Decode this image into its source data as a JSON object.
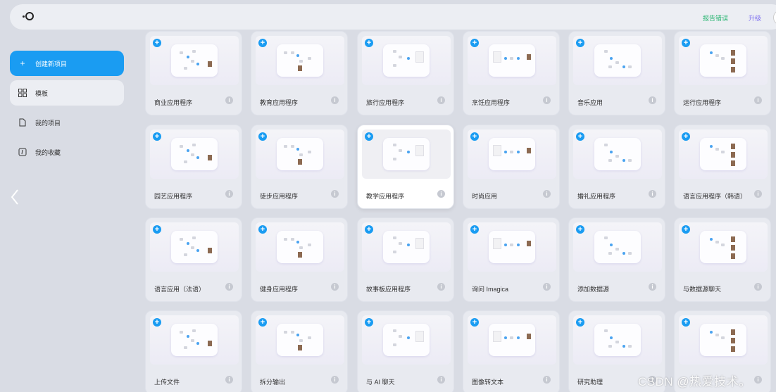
{
  "header": {
    "feedback_label": "报告错误",
    "upgrade_label": "升级"
  },
  "sidebar": {
    "items": [
      {
        "label": "创建新项目",
        "icon": "plus-icon"
      },
      {
        "label": "模板",
        "icon": "grid-icon"
      },
      {
        "label": "我的项目",
        "icon": "file-icon"
      },
      {
        "label": "我的收藏",
        "icon": "bookmark-icon"
      }
    ]
  },
  "templates": [
    {
      "title": "商业应用程序"
    },
    {
      "title": "教育应用程序"
    },
    {
      "title": "旅行应用程序"
    },
    {
      "title": "烹饪应用程序"
    },
    {
      "title": "音乐应用"
    },
    {
      "title": "运行应用程序"
    },
    {
      "title": "园艺应用程序"
    },
    {
      "title": "徒步应用程序"
    },
    {
      "title": "教学应用程序"
    },
    {
      "title": "时尚应用"
    },
    {
      "title": "婚礼应用程序"
    },
    {
      "title": "语言应用程序（韩语）"
    },
    {
      "title": "语言应用（法语）"
    },
    {
      "title": "健身应用程序"
    },
    {
      "title": "故事板应用程序"
    },
    {
      "title": "询问 Imagica"
    },
    {
      "title": "添加数据源"
    },
    {
      "title": "与数据源聊天"
    },
    {
      "title": "上传文件"
    },
    {
      "title": "拆分输出"
    },
    {
      "title": "与 AI 聊天"
    },
    {
      "title": "图像转文本"
    },
    {
      "title": "研究助理"
    },
    {
      "title": ""
    }
  ],
  "watermark": "CSDN @热爱技术。",
  "colors": {
    "accent": "#1a9cf2",
    "feedback": "#2bb673",
    "upgrade": "#7b6cf0"
  }
}
